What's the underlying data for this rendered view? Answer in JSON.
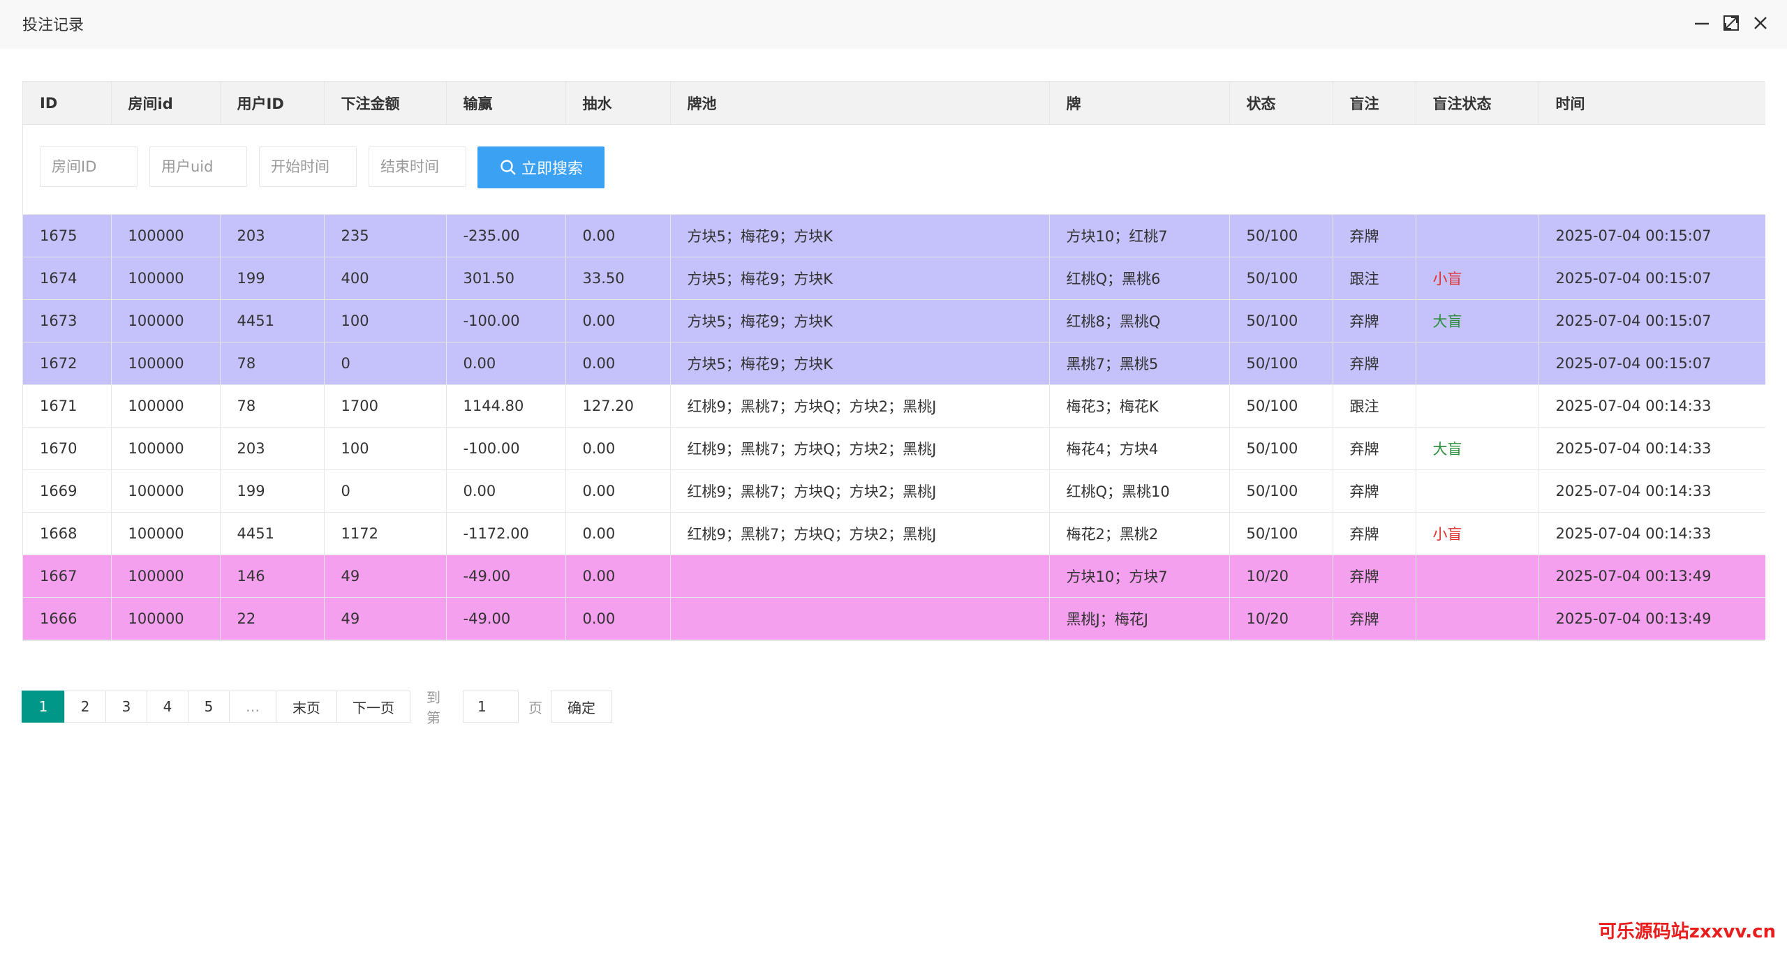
{
  "window": {
    "title": "投注记录",
    "controls": [
      "minimize-icon",
      "maximize-icon",
      "close-icon"
    ]
  },
  "table": {
    "headers": [
      "ID",
      "房间id",
      "用户ID",
      "下注金额",
      "输赢",
      "抽水",
      "牌池",
      "牌",
      "状态",
      "盲注",
      "盲注状态",
      "时间"
    ],
    "rows": [
      {
        "id": "1675",
        "room": "100000",
        "user": "203",
        "bet": "235",
        "win": "-235.00",
        "rake": "0.00",
        "pool": "方块5；梅花9；方块K",
        "cards": "方块10；红桃7",
        "status": "50/100",
        "blind": "弃牌",
        "blind_status": "",
        "time": "2025-07-04 00:15:07",
        "bg": "#c4c1fb"
      },
      {
        "id": "1674",
        "room": "100000",
        "user": "199",
        "bet": "400",
        "win": "301.50",
        "rake": "33.50",
        "pool": "方块5；梅花9；方块K",
        "cards": "红桃Q；黑桃6",
        "status": "50/100",
        "blind": "跟注",
        "blind_status": "小盲",
        "time": "2025-07-04 00:15:07",
        "bg": "#c4c1fb"
      },
      {
        "id": "1673",
        "room": "100000",
        "user": "4451",
        "bet": "100",
        "win": "-100.00",
        "rake": "0.00",
        "pool": "方块5；梅花9；方块K",
        "cards": "红桃8；黑桃Q",
        "status": "50/100",
        "blind": "弃牌",
        "blind_status": "大盲",
        "time": "2025-07-04 00:15:07",
        "bg": "#c4c1fb"
      },
      {
        "id": "1672",
        "room": "100000",
        "user": "78",
        "bet": "0",
        "win": "0.00",
        "rake": "0.00",
        "pool": "方块5；梅花9；方块K",
        "cards": "黑桃7；黑桃5",
        "status": "50/100",
        "blind": "弃牌",
        "blind_status": "",
        "time": "2025-07-04 00:15:07",
        "bg": "#c4c1fb"
      },
      {
        "id": "1671",
        "room": "100000",
        "user": "78",
        "bet": "1700",
        "win": "1144.80",
        "rake": "127.20",
        "pool": "红桃9；黑桃7；方块Q；方块2；黑桃J",
        "cards": "梅花3；梅花K",
        "status": "50/100",
        "blind": "跟注",
        "blind_status": "",
        "time": "2025-07-04 00:14:33",
        "bg": "#ffffff"
      },
      {
        "id": "1670",
        "room": "100000",
        "user": "203",
        "bet": "100",
        "win": "-100.00",
        "rake": "0.00",
        "pool": "红桃9；黑桃7；方块Q；方块2；黑桃J",
        "cards": "梅花4；方块4",
        "status": "50/100",
        "blind": "弃牌",
        "blind_status": "大盲",
        "time": "2025-07-04 00:14:33",
        "bg": "#ffffff"
      },
      {
        "id": "1669",
        "room": "100000",
        "user": "199",
        "bet": "0",
        "win": "0.00",
        "rake": "0.00",
        "pool": "红桃9；黑桃7；方块Q；方块2；黑桃J",
        "cards": "红桃Q；黑桃10",
        "status": "50/100",
        "blind": "弃牌",
        "blind_status": "",
        "time": "2025-07-04 00:14:33",
        "bg": "#ffffff"
      },
      {
        "id": "1668",
        "room": "100000",
        "user": "4451",
        "bet": "1172",
        "win": "-1172.00",
        "rake": "0.00",
        "pool": "红桃9；黑桃7；方块Q；方块2；黑桃J",
        "cards": "梅花2；黑桃2",
        "status": "50/100",
        "blind": "弃牌",
        "blind_status": "小盲",
        "time": "2025-07-04 00:14:33",
        "bg": "#ffffff"
      },
      {
        "id": "1667",
        "room": "100000",
        "user": "146",
        "bet": "49",
        "win": "-49.00",
        "rake": "0.00",
        "pool": "",
        "cards": "方块10；方块7",
        "status": "10/20",
        "blind": "弃牌",
        "blind_status": "",
        "time": "2025-07-04 00:13:49",
        "bg": "#f5a0ee"
      },
      {
        "id": "1666",
        "room": "100000",
        "user": "22",
        "bet": "49",
        "win": "-49.00",
        "rake": "0.00",
        "pool": "",
        "cards": "黑桃J；梅花J",
        "status": "10/20",
        "blind": "弃牌",
        "blind_status": "",
        "time": "2025-07-04 00:13:49",
        "bg": "#f5a0ee"
      }
    ]
  },
  "search": {
    "room_placeholder": "房间ID",
    "uid_placeholder": "用户uid",
    "start_placeholder": "开始时间",
    "end_placeholder": "结束时间",
    "button_label": "立即搜索",
    "button_icon": "search-icon"
  },
  "pagination": {
    "pages": [
      "1",
      "2",
      "3",
      "4",
      "5"
    ],
    "active_page": "1",
    "ellipsis": "…",
    "last_label": "末页",
    "next_label": "下一页",
    "goto_prefix": "到第",
    "goto_value": "1",
    "goto_suffix": "页",
    "confirm_label": "确定"
  },
  "watermark": "可乐源码站zxxvv.cn",
  "colors": {
    "purple_row": "#c4c1fb",
    "pink_row": "#f5a0ee",
    "search_button": "#3aa1f3",
    "active_page": "#009688",
    "small_blind": "#e0322e",
    "big_blind": "#2b8e3a"
  }
}
